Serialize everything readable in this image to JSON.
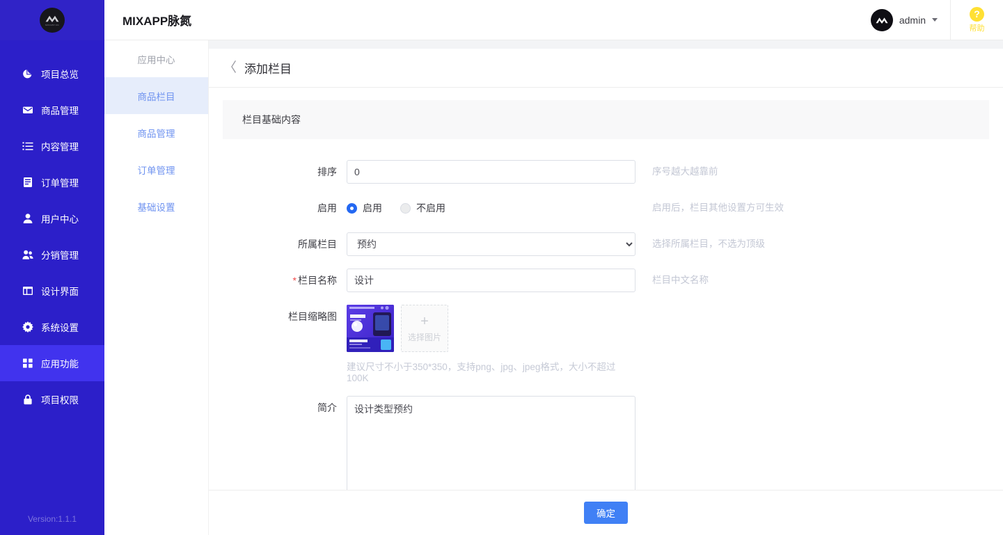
{
  "brand": {
    "logo_text": "MIXAPP.CN",
    "title": "MIXAPP脉氮"
  },
  "topbar": {
    "user_name": "admin",
    "help_glyph": "?",
    "help_label": "帮助"
  },
  "sidebar": {
    "version": "Version:1.1.1",
    "items": [
      {
        "label": "项目总览",
        "icon": "pie-chart-icon",
        "active": false
      },
      {
        "label": "商品管理",
        "icon": "mail-icon",
        "active": false
      },
      {
        "label": "内容管理",
        "icon": "list-icon",
        "active": false
      },
      {
        "label": "订单管理",
        "icon": "document-icon",
        "active": false
      },
      {
        "label": "用户中心",
        "icon": "user-icon",
        "active": false
      },
      {
        "label": "分销管理",
        "icon": "users-group-icon",
        "active": false
      },
      {
        "label": "设计界面",
        "icon": "layout-icon",
        "active": false
      },
      {
        "label": "系统设置",
        "icon": "gear-icon",
        "active": false
      },
      {
        "label": "应用功能",
        "icon": "grid-apps-icon",
        "active": true
      },
      {
        "label": "项目权限",
        "icon": "lock-icon",
        "active": false
      }
    ]
  },
  "subnav": {
    "heading": "应用中心",
    "items": [
      {
        "label": "商品栏目",
        "active": true
      },
      {
        "label": "商品管理",
        "active": false
      },
      {
        "label": "订单管理",
        "active": false
      },
      {
        "label": "基础设置",
        "active": false
      }
    ]
  },
  "page": {
    "back_glyph": "〈",
    "title": "添加栏目",
    "section_title": "栏目基础内容",
    "confirm_label": "确定"
  },
  "form": {
    "sort": {
      "label": "排序",
      "value": "0",
      "placeholder": "",
      "hint": "序号越大越靠前"
    },
    "enable": {
      "label": "启用",
      "hint": "启用后，栏目其他设置方可生效",
      "options": [
        {
          "label": "启用",
          "selected": true
        },
        {
          "label": "不启用",
          "selected": false
        }
      ]
    },
    "parent": {
      "label": "所属栏目",
      "value": "预约",
      "hint": "选择所属栏目，不选为顶级",
      "options": [
        "预约"
      ]
    },
    "name": {
      "label": "栏目名称",
      "required_mark": "*",
      "value": "设计",
      "placeholder": "",
      "hint": "栏目中文名称"
    },
    "thumbnail": {
      "label": "栏目缩略图",
      "add_glyph": "+",
      "add_label": "选择图片",
      "note": "建议尺寸不小于350*350，支持png、jpg、jpeg格式，大小不超过100K"
    },
    "intro": {
      "label": "简介",
      "value": "设计类型预约",
      "placeholder": ""
    }
  }
}
